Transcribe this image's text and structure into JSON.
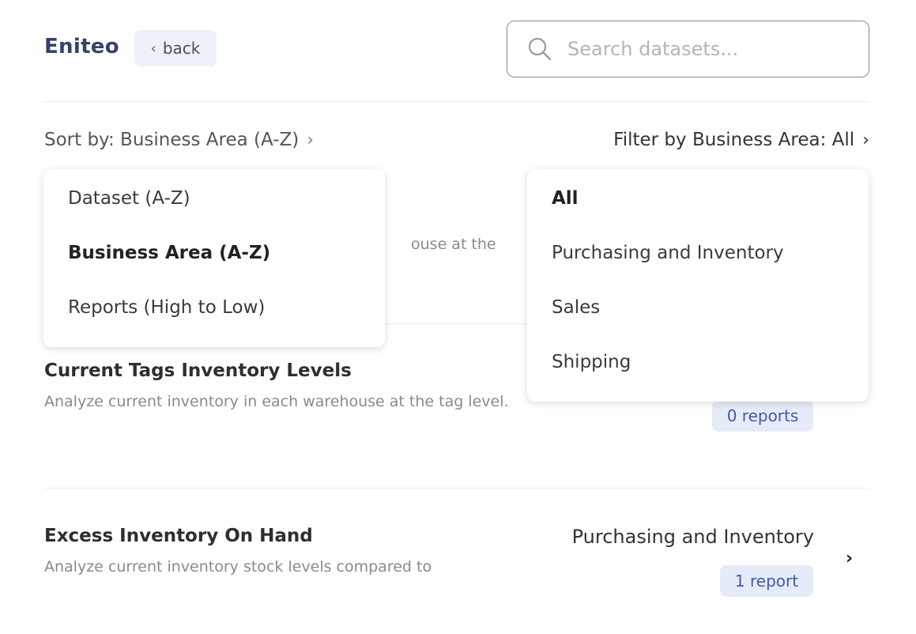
{
  "header": {
    "brand": "Eniteo",
    "back_label": "back",
    "search_placeholder": "Search datasets..."
  },
  "controls": {
    "sort_label": "Sort by: Business Area (A-Z)",
    "filter_label": "Filter by Business Area: All"
  },
  "sort_menu": {
    "items": [
      {
        "label": "Dataset (A-Z)"
      },
      {
        "label": "Business Area (A-Z)"
      },
      {
        "label": "Reports (High to Low)"
      }
    ]
  },
  "filter_menu": {
    "items": [
      {
        "label": "All"
      },
      {
        "label": "Purchasing and Inventory"
      },
      {
        "label": "Sales"
      },
      {
        "label": "Shipping"
      }
    ]
  },
  "datasets": [
    {
      "partial_desc": "ouse at the"
    },
    {
      "title": "Current Tags Inventory Levels",
      "desc": "Analyze current inventory in each warehouse at the tag level.",
      "reports": "0 reports"
    },
    {
      "title": "Excess Inventory On Hand",
      "desc": "Analyze current inventory stock levels compared to",
      "area": "Purchasing and Inventory",
      "reports": "1 report"
    }
  ]
}
